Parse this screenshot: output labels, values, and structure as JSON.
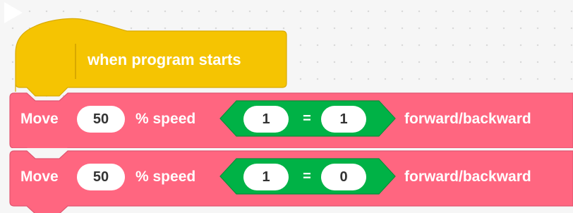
{
  "colors": {
    "events_yellow": "#f5c402",
    "motor_red": "#ff6680",
    "operator_green": "#00b246",
    "canvas": "#f6f6f6"
  },
  "hat_block": {
    "icon": "play-icon",
    "label": "when program starts"
  },
  "move_blocks": [
    {
      "label": "Move",
      "speed": "50",
      "speed_unit": "% speed",
      "condition": {
        "left": "1",
        "operator": "=",
        "right": "1"
      },
      "direction": "forward/backward"
    },
    {
      "label": "Move",
      "speed": "50",
      "speed_unit": "% speed",
      "condition": {
        "left": "1",
        "operator": "=",
        "right": "0"
      },
      "direction": "forward/backward"
    }
  ]
}
